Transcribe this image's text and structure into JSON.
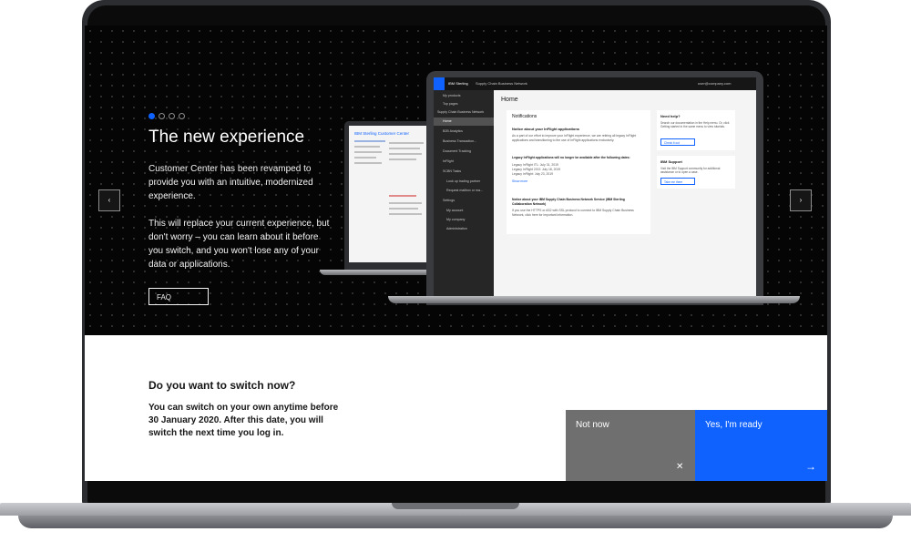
{
  "hero": {
    "title": "The new experience",
    "para1": "Customer Center has been revamped to provide you with an intuitive, modernized experience.",
    "para2": "This will replace your current experience, but don't worry – you can learn about it before you switch, and you won't lose any of your data or applications.",
    "faq_label": "FAQ",
    "carousel_total": 4,
    "carousel_active": 1,
    "prev_icon": "‹",
    "next_icon": "›"
  },
  "switch": {
    "title": "Do you want to switch now?",
    "text": "You can switch on your own anytime before 30 January 2020. After this date, you will switch the next time you log in.",
    "not_now_label": "Not now",
    "not_now_icon": "✕",
    "ready_label": "Yes, I'm ready",
    "ready_icon": "→"
  },
  "mockup": {
    "brand": "IBM Sterling",
    "product": "Supply Chain Business Network",
    "user": "user@company.com",
    "side_items": [
      "My products",
      "Top pages",
      "Supply Chain Business Network",
      "Home",
      "B2B Analytics",
      "Business Transaction...",
      "Document Tracking",
      "InFlight",
      "SCBN Tasks",
      "Look up trading partner",
      "Request mailbox or ma...",
      "Settings",
      "My account",
      "My company",
      "Administration"
    ],
    "page_title": "Home",
    "notifications_title": "Notifications",
    "notice1_title": "Notice about your InFlight applications",
    "notice1_text": "As a part of our effort to improve your InFlight experience, we are retiring all legacy InFlight applications and transitioning to the use of InFlight applications exclusively.",
    "notice1_sub": "Legacy InFlight applications will no longer be available after the following dates:",
    "notice1_dates": [
      "Legacy InFlight ITL: July 31, 2019",
      "Legacy InFlight 2GO: July 18, 2019",
      "Legacy InFlight: July 23, 2019"
    ],
    "notice1_link": "Show more",
    "notice2_title": "Notice about your IBM Supply Chain Business Network Service (IBM Sterling Collaboration Network)",
    "notice2_text": "If you use the HTTPS or AS2 with SSL protocol to connect to IBM Supply Chain Business Network, click here for important information.",
    "help_title": "Need help?",
    "help_text": "Search our documentation in the Help menu. Or, click Getting started in the same menu to view tutorials.",
    "help_link": "Check it out",
    "support_title": "IBM Support",
    "support_text": "Visit the IBM Support community for additional assistance or to open a case.",
    "support_link": "Take me there",
    "small_title": "IBM Sterling Customer Center"
  },
  "colors": {
    "accent": "#0f62fe",
    "not_now_bg": "#6f6f6f",
    "hero_bg": "#050505"
  }
}
